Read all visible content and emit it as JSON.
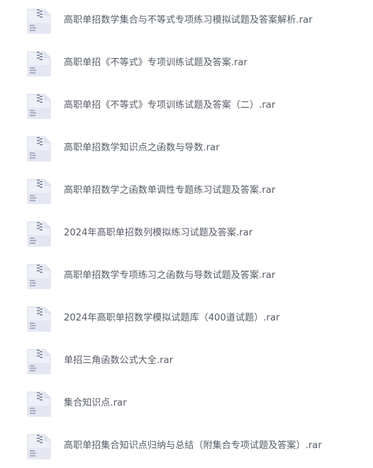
{
  "file_list": {
    "icon": "archive-file-icon",
    "items": [
      {
        "name": "高职单招数学集合与不等式专项练习模拟试题及答案解析.rar"
      },
      {
        "name": "高职单招《不等式》专项训练试题及答案.rar"
      },
      {
        "name": "高职单招《不等式》专项训练试题及答案（二）.rar"
      },
      {
        "name": "高职单招数学知识点之函数与导数.rar"
      },
      {
        "name": "高职单招数学之函数单调性专题练习试题及答案.rar"
      },
      {
        "name": "2024年高职单招数列模拟练习试题及答案.rar"
      },
      {
        "name": "高职单招数学专项练习之函数与导数试题及答案.rar"
      },
      {
        "name": "2024年高职单招数学模拟试题库（400道试题）.rar"
      },
      {
        "name": "单招三角函数公式大全.rar"
      },
      {
        "name": "集合知识点.rar"
      },
      {
        "name": "高职单招集合知识点归纳与总结（附集合专项试题及答案）.rar"
      }
    ]
  }
}
